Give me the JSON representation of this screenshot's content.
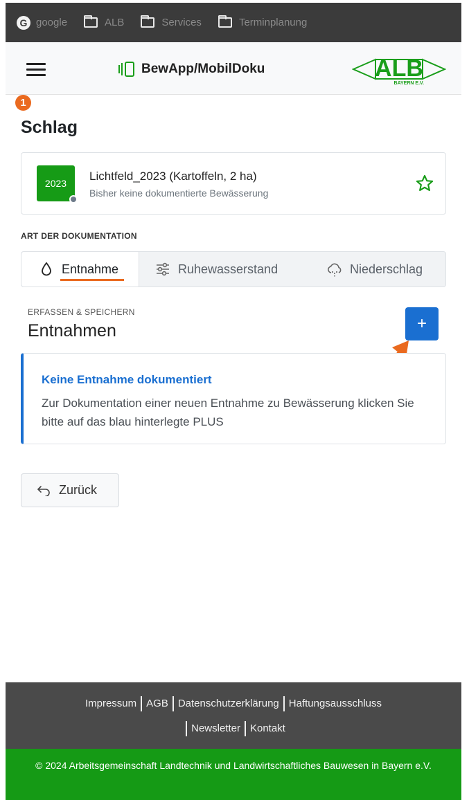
{
  "bookmarks": [
    {
      "label": "google",
      "icon": "google-icon"
    },
    {
      "label": "ALB",
      "icon": "folder-icon"
    },
    {
      "label": "Services",
      "icon": "folder-icon"
    },
    {
      "label": "Terminplanung",
      "icon": "folder-icon"
    }
  ],
  "header": {
    "brand": "BewApp/MobilDoku",
    "logo_text": "ALB",
    "logo_sub": "BAYERN E.V."
  },
  "step_badge": "1",
  "page_title": "Schlag",
  "field_card": {
    "year": "2023",
    "title": "Lichtfeld_2023 (Kartoffeln, 2 ha)",
    "subtitle": "Bisher keine dokumentierte Bewässerung"
  },
  "doc_type_label": "ART DER DOKUMENTATION",
  "tabs": [
    {
      "label": "Entnahme",
      "icon": "droplet-icon",
      "active": true
    },
    {
      "label": "Ruhewasserstand",
      "icon": "sliders-icon",
      "active": false
    },
    {
      "label": "Niederschlag",
      "icon": "cloud-rain-icon",
      "active": false
    }
  ],
  "section": {
    "caption": "ERFASSEN & SPEICHERN",
    "title": "Entnahmen",
    "add_label": "+"
  },
  "info": {
    "title": "Keine Entnahme dokumentiert",
    "text": "Zur Dokumentation einer neuen Entnahme zu Bewässerung klicken Sie bitte auf das blau hinterlegte PLUS"
  },
  "back_label": "Zurück",
  "footer": {
    "links_row1": [
      "Impressum",
      "AGB",
      "Datenschutzerklärung",
      "Haftungsausschluss"
    ],
    "links_row2": [
      "Newsletter",
      "Kontakt"
    ],
    "copyright": "© 2024 Arbeitsgemeinschaft Landtechnik und Landwirtschaftliches Bauwesen in Bayern e.V."
  },
  "colors": {
    "accent_blue": "#1a6fd1",
    "brand_green": "#159a15",
    "annotation_orange": "#ea6a1f",
    "footer_gray": "#4a4a4a"
  }
}
